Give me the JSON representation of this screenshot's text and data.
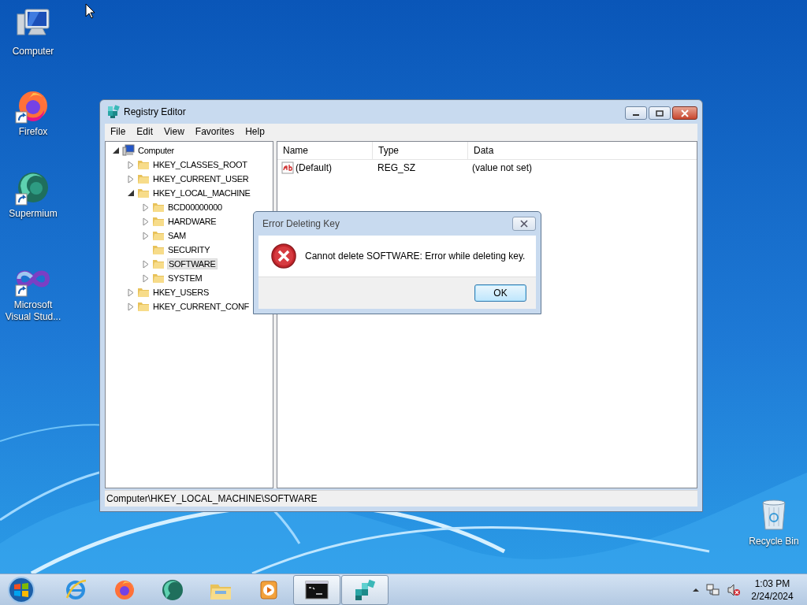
{
  "desktop_icons": [
    {
      "label": "Computer",
      "kind": "computer",
      "shortcut": false
    },
    {
      "label": "Firefox",
      "kind": "firefox",
      "shortcut": true
    },
    {
      "label": "Supermium",
      "kind": "supermium",
      "shortcut": true
    },
    {
      "label": "Microsoft Visual Stud...",
      "kind": "visualstudio",
      "shortcut": true
    },
    {
      "label": "Recycle Bin",
      "kind": "recycle",
      "shortcut": false
    }
  ],
  "registry_window": {
    "title": "Registry Editor",
    "menu": [
      "File",
      "Edit",
      "View",
      "Favorites",
      "Help"
    ],
    "tree": [
      {
        "label": "Computer",
        "kind": "computer",
        "expandable": true,
        "expanded": true,
        "selected": false,
        "children": [
          {
            "label": "HKEY_CLASSES_ROOT",
            "kind": "folder",
            "expandable": true,
            "expanded": false,
            "selected": false
          },
          {
            "label": "HKEY_CURRENT_USER",
            "kind": "folder",
            "expandable": true,
            "expanded": false,
            "selected": false
          },
          {
            "label": "HKEY_LOCAL_MACHINE",
            "kind": "folder",
            "expandable": true,
            "expanded": true,
            "selected": false,
            "children": [
              {
                "label": "BCD00000000",
                "kind": "folder",
                "expandable": true,
                "expanded": false,
                "selected": false
              },
              {
                "label": "HARDWARE",
                "kind": "folder",
                "expandable": true,
                "expanded": false,
                "selected": false
              },
              {
                "label": "SAM",
                "kind": "folder",
                "expandable": true,
                "expanded": false,
                "selected": false
              },
              {
                "label": "SECURITY",
                "kind": "folder",
                "expandable": false,
                "expanded": false,
                "selected": false
              },
              {
                "label": "SOFTWARE",
                "kind": "folder",
                "expandable": true,
                "expanded": false,
                "selected": true
              },
              {
                "label": "SYSTEM",
                "kind": "folder",
                "expandable": true,
                "expanded": false,
                "selected": false
              }
            ]
          },
          {
            "label": "HKEY_USERS",
            "kind": "folder",
            "expandable": true,
            "expanded": false,
            "selected": false
          },
          {
            "label": "HKEY_CURRENT_CONF",
            "kind": "folder",
            "expandable": true,
            "expanded": false,
            "selected": false
          }
        ]
      }
    ],
    "columns": [
      "Name",
      "Type",
      "Data"
    ],
    "rows": [
      {
        "name": "(Default)",
        "type": "REG_SZ",
        "data": "(value not set)"
      }
    ],
    "status_bar": "Computer\\HKEY_LOCAL_MACHINE\\SOFTWARE"
  },
  "dialog": {
    "title": "Error Deleting Key",
    "message": "Cannot delete SOFTWARE:  Error while deleting key.",
    "button": "OK"
  },
  "taskbar": {
    "items": [
      {
        "kind": "ie",
        "active": false
      },
      {
        "kind": "firefox",
        "active": false
      },
      {
        "kind": "supermium",
        "active": false
      },
      {
        "kind": "explorer",
        "active": false
      },
      {
        "kind": "mediaplayer",
        "active": false
      },
      {
        "kind": "cmd",
        "active": true
      },
      {
        "kind": "regedit",
        "active": true
      }
    ],
    "time": "1:03 PM",
    "date": "2/24/2024",
    "volume_muted": true
  }
}
